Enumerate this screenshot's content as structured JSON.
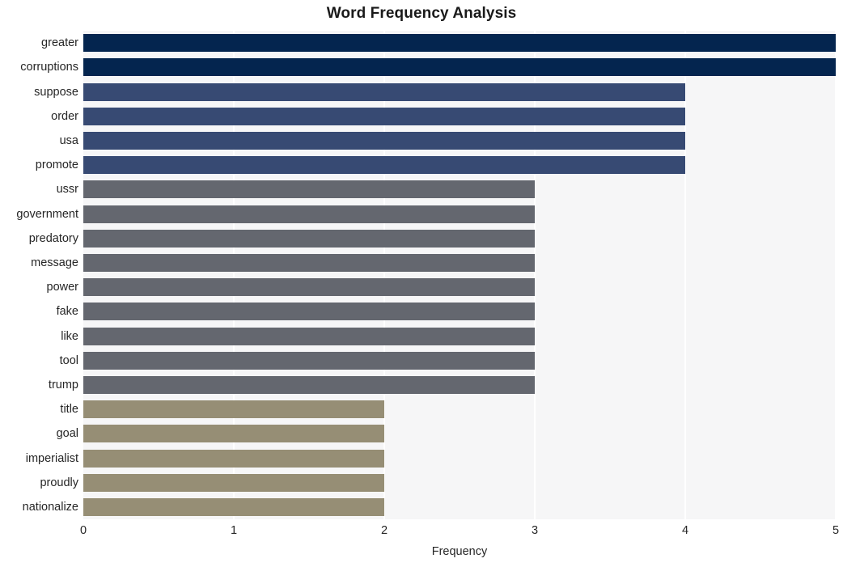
{
  "chart_data": {
    "type": "bar",
    "orientation": "horizontal",
    "title": "Word Frequency Analysis",
    "xlabel": "Frequency",
    "ylabel": "",
    "xlim": [
      0,
      5
    ],
    "xticks": [
      "0",
      "1",
      "2",
      "3",
      "4",
      "5"
    ],
    "grid": "vertical-white",
    "legend": "none",
    "categories": [
      "greater",
      "corruptions",
      "suppose",
      "order",
      "usa",
      "promote",
      "ussr",
      "government",
      "predatory",
      "message",
      "power",
      "fake",
      "like",
      "tool",
      "trump",
      "title",
      "goal",
      "imperialist",
      "proudly",
      "nationalize"
    ],
    "values": [
      5,
      5,
      4,
      4,
      4,
      4,
      3,
      3,
      3,
      3,
      3,
      3,
      3,
      3,
      3,
      2,
      2,
      2,
      2,
      2
    ],
    "bar_colors": [
      "#04254f",
      "#04254f",
      "#374a73",
      "#374a73",
      "#374a73",
      "#374a73",
      "#64676f",
      "#64676f",
      "#64676f",
      "#64676f",
      "#64676f",
      "#64676f",
      "#64676f",
      "#64676f",
      "#64676f",
      "#968e75",
      "#968e75",
      "#968e75",
      "#968e75",
      "#968e75"
    ],
    "colors": {
      "plot_background": "#f6f6f7",
      "figure_background": "#ffffff",
      "gridline": "#ffffff",
      "text": "#262626",
      "title": "#1a1a1a"
    }
  }
}
